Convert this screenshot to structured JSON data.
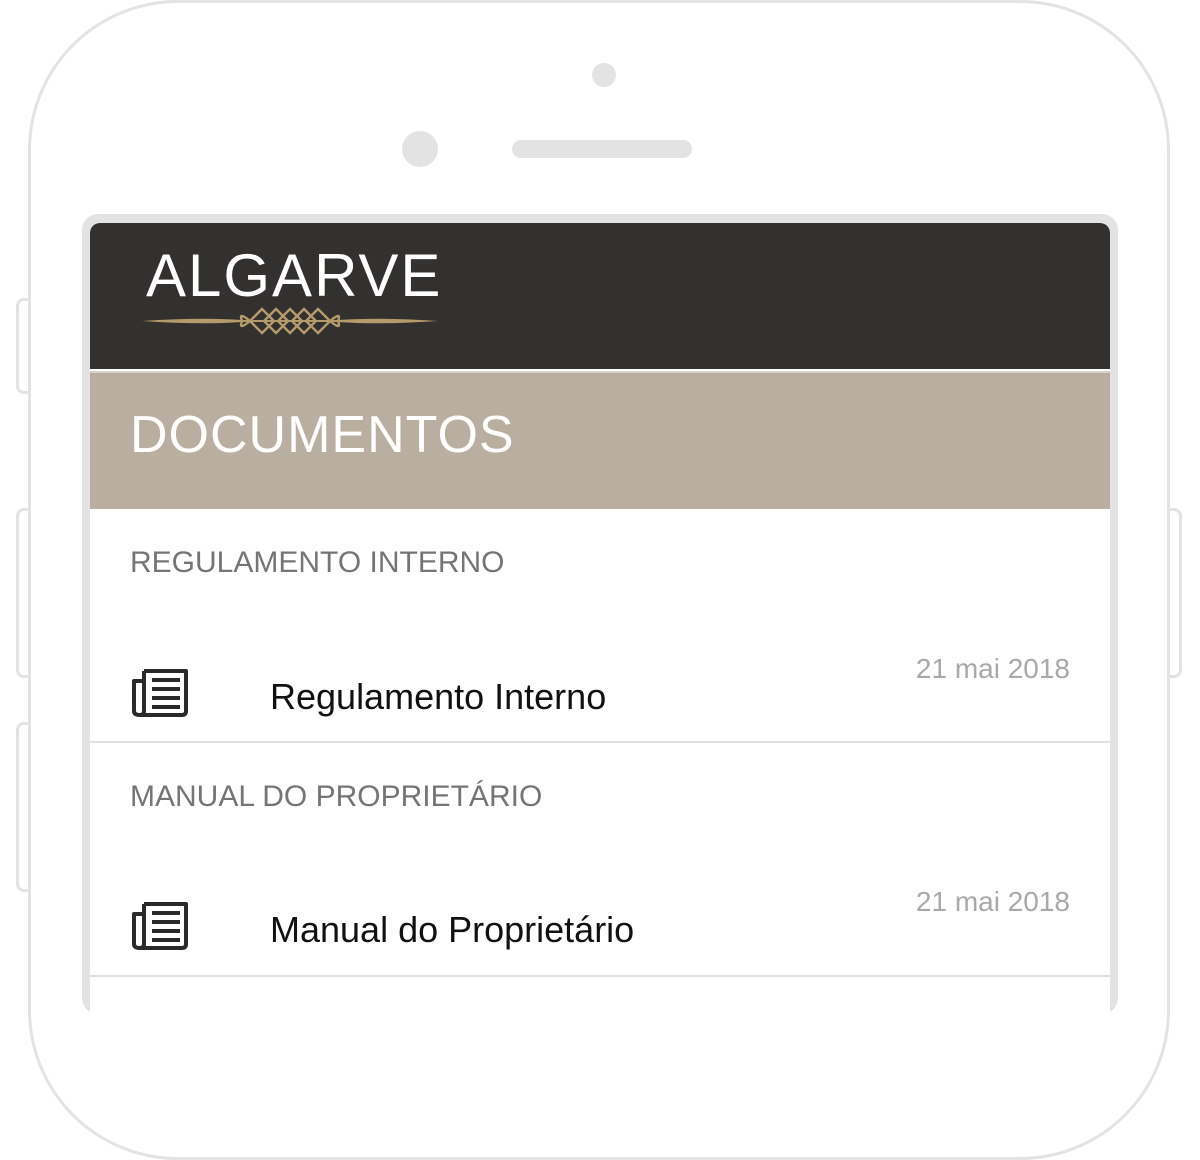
{
  "app": {
    "logo_text": "ALGARVE"
  },
  "page": {
    "title": "DOCUMENTOS"
  },
  "sections": [
    {
      "header": "REGULAMENTO INTERNO",
      "item": {
        "label": "Regulamento Interno",
        "date": "21 mai 2018",
        "icon": "document-icon"
      }
    },
    {
      "header": "MANUAL DO PROPRIETÁRIO",
      "item": {
        "label": "Manual do Proprietário",
        "date": "21 mai 2018",
        "icon": "document-icon"
      }
    }
  ],
  "colors": {
    "header_bg": "#33312f",
    "title_bar_bg": "#b8afa1",
    "accent_gold": "#b59a6a"
  }
}
